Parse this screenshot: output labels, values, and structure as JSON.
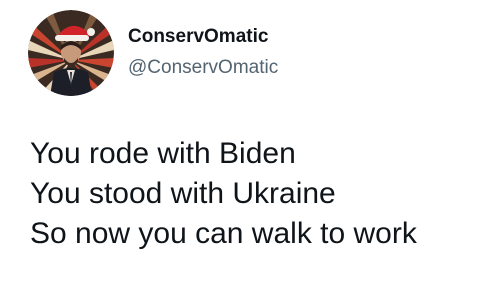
{
  "author": {
    "display_name": "ConservOmatic",
    "handle": "@ConservOmatic",
    "avatar_icon": "santa-hat-portrait-avatar"
  },
  "tweet": {
    "lines": [
      "You rode with Biden",
      "You stood with Ukraine",
      "So now you can walk to work"
    ]
  },
  "colors": {
    "text_primary": "#0f1419",
    "text_secondary": "#536471",
    "background": "#ffffff"
  }
}
